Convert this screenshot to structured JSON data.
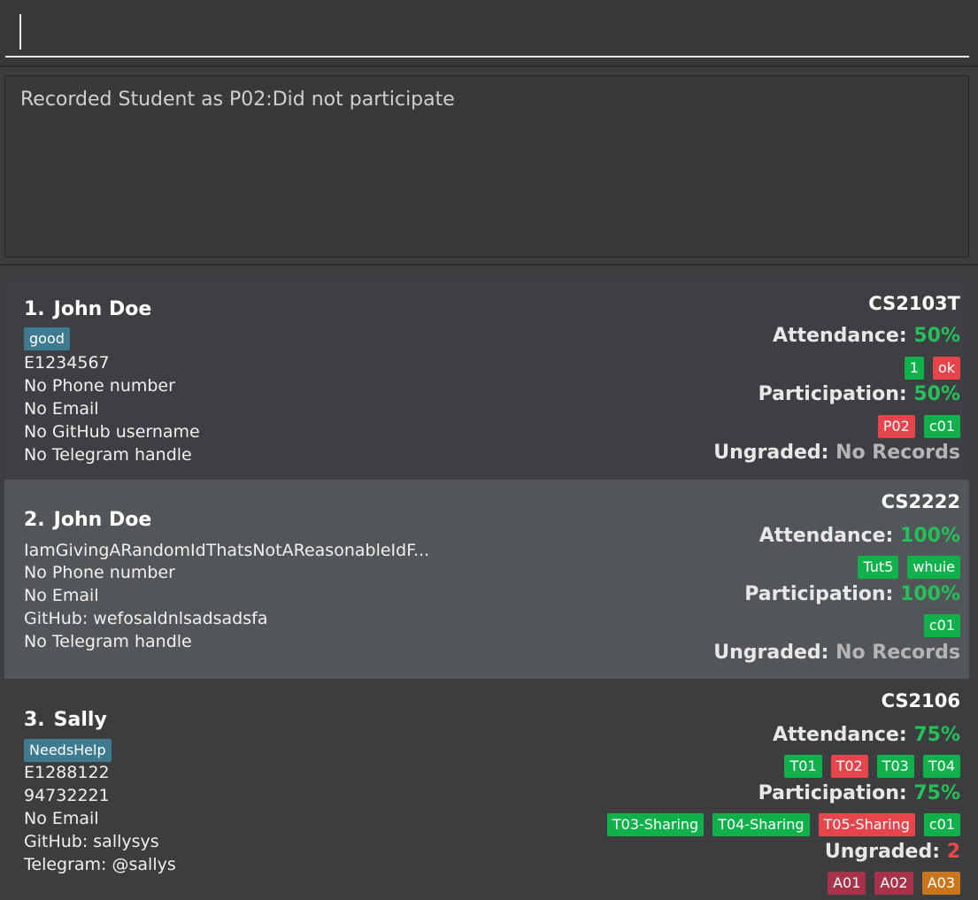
{
  "command": {
    "value": "",
    "placeholder": ""
  },
  "result": {
    "message": "Recorded Student as P02:Did not participate"
  },
  "students": [
    {
      "index": "1.",
      "name": "John Doe",
      "tags": [
        "good"
      ],
      "id": "E1234567",
      "phone": "No Phone number",
      "email": "No Email",
      "github": "No GitHub username",
      "telegram": "No Telegram handle",
      "module": "CS2103T",
      "attendance_label": "Attendance:",
      "attendance_pct": "50%",
      "attendance_badges": [
        {
          "label": "1",
          "status": "present",
          "color": "#10b14b"
        },
        {
          "label": "ok",
          "status": "absent",
          "color": "#e5454b"
        }
      ],
      "participation_label": "Participation:",
      "participation_pct": "50%",
      "participation_badges": [
        {
          "label": "P02",
          "status": "absent",
          "color": "#e5454b"
        },
        {
          "label": "c01",
          "status": "present",
          "color": "#10b14b"
        }
      ],
      "ungraded_label": "Ungraded:",
      "ungraded_value": "No Records",
      "ungraded_badges": []
    },
    {
      "index": "2.",
      "name": "John Doe",
      "tags": [],
      "id": "IamGivingARandomIdThatsNotAReasonableIdF...",
      "phone": "No Phone number",
      "email": "No Email",
      "github": "GitHub: wefosaldnlsadsadsfa",
      "telegram": "No Telegram handle",
      "module": "CS2222",
      "attendance_label": "Attendance:",
      "attendance_pct": "100%",
      "attendance_badges": [
        {
          "label": "Tut5",
          "status": "present",
          "color": "#10b14b"
        },
        {
          "label": "whuie",
          "status": "present",
          "color": "#10b14b"
        }
      ],
      "participation_label": "Participation:",
      "participation_pct": "100%",
      "participation_badges": [
        {
          "label": "c01",
          "status": "present",
          "color": "#10b14b"
        }
      ],
      "ungraded_label": "Ungraded:",
      "ungraded_value": "No Records",
      "ungraded_badges": []
    },
    {
      "index": "3.",
      "name": "Sally",
      "tags": [
        "NeedsHelp"
      ],
      "id": "E1288122",
      "phone": "94732221",
      "email": "No Email",
      "github": "GitHub: sallysys",
      "telegram": "Telegram: @sallys",
      "module": "CS2106",
      "attendance_label": "Attendance:",
      "attendance_pct": "75%",
      "attendance_badges": [
        {
          "label": "T01",
          "status": "present",
          "color": "#10b14b"
        },
        {
          "label": "T02",
          "status": "absent",
          "color": "#e5454b"
        },
        {
          "label": "T03",
          "status": "present",
          "color": "#10b14b"
        },
        {
          "label": "T04",
          "status": "present",
          "color": "#10b14b"
        }
      ],
      "participation_label": "Participation:",
      "participation_pct": "75%",
      "participation_badges": [
        {
          "label": "T03-Sharing",
          "status": "present",
          "color": "#10b14b"
        },
        {
          "label": "T04-Sharing",
          "status": "present",
          "color": "#10b14b"
        },
        {
          "label": "T05-Sharing",
          "status": "absent",
          "color": "#e5454b"
        },
        {
          "label": "c01",
          "status": "present",
          "color": "#10b14b"
        }
      ],
      "ungraded_label": "Ungraded:",
      "ungraded_value": "2",
      "ungraded_badges": [
        {
          "label": "A01",
          "color": "#a8324a"
        },
        {
          "label": "A02",
          "color": "#a8324a"
        },
        {
          "label": "A03",
          "color": "#c8751b"
        }
      ]
    }
  ]
}
